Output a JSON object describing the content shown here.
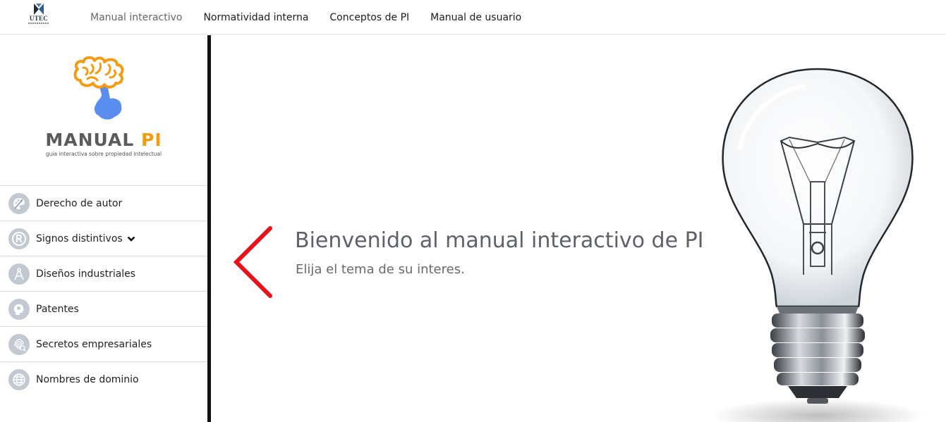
{
  "header": {
    "logo_text": "UTEC",
    "nav": [
      {
        "label": "Manual interactivo",
        "active": true
      },
      {
        "label": "Normatividad interna",
        "active": false
      },
      {
        "label": "Conceptos de PI",
        "active": false
      },
      {
        "label": "Manual de usuario",
        "active": false
      }
    ]
  },
  "sidebar": {
    "brand": {
      "title_main": "MANUAL ",
      "title_accent": "PI",
      "subtitle": "guia interactiva sobre propiedad intelectual"
    },
    "items": [
      {
        "label": "Derecho de autor",
        "icon": "palette-icon"
      },
      {
        "label": "Signos distintivos",
        "icon": "registered-icon",
        "has_dropdown": true
      },
      {
        "label": "Diseños industriales",
        "icon": "compass-icon"
      },
      {
        "label": "Patentes",
        "icon": "lightbulb-head-icon"
      },
      {
        "label": "Secretos empresariales",
        "icon": "fingerprint-icon"
      },
      {
        "label": "Nombres de dominio",
        "icon": "globe-icon"
      }
    ]
  },
  "main": {
    "title": "Bienvenido al manual interactivo de PI",
    "subtitle": "Elija el tema de su interes."
  },
  "colors": {
    "accent_orange": "#f39c12",
    "brain_blue": "#5b8def",
    "arrow_red": "#e8141b",
    "divider": "#111111",
    "icon_bg": "#c3c9d2"
  }
}
